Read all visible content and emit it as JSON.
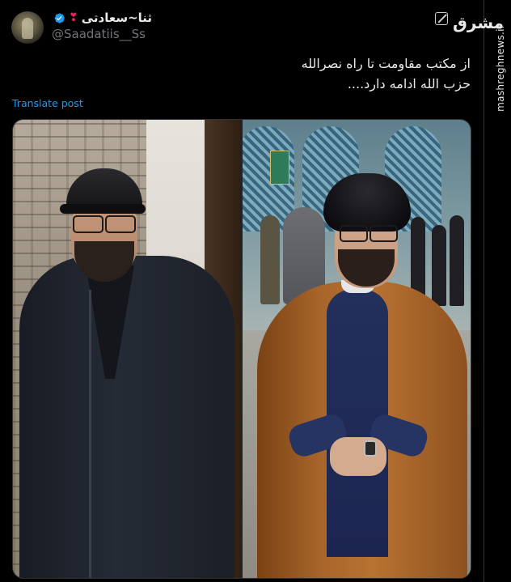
{
  "user": {
    "display_name": "ثنا~سعادتی",
    "handle": "@Saadatiis__Ss",
    "verified": true,
    "accent_color": "#1d9bf0"
  },
  "tweet": {
    "line1": "از مکتب مقاومت تا راه نصرالله",
    "line2": "حزب الله ادامه دارد...."
  },
  "actions": {
    "translate_label": "Translate post"
  },
  "watermark": {
    "logo_text": "مشرق",
    "site": "mashreghnews.ir"
  },
  "icons": [
    "verified-badge-icon",
    "heart-icon",
    "grok-icon"
  ]
}
